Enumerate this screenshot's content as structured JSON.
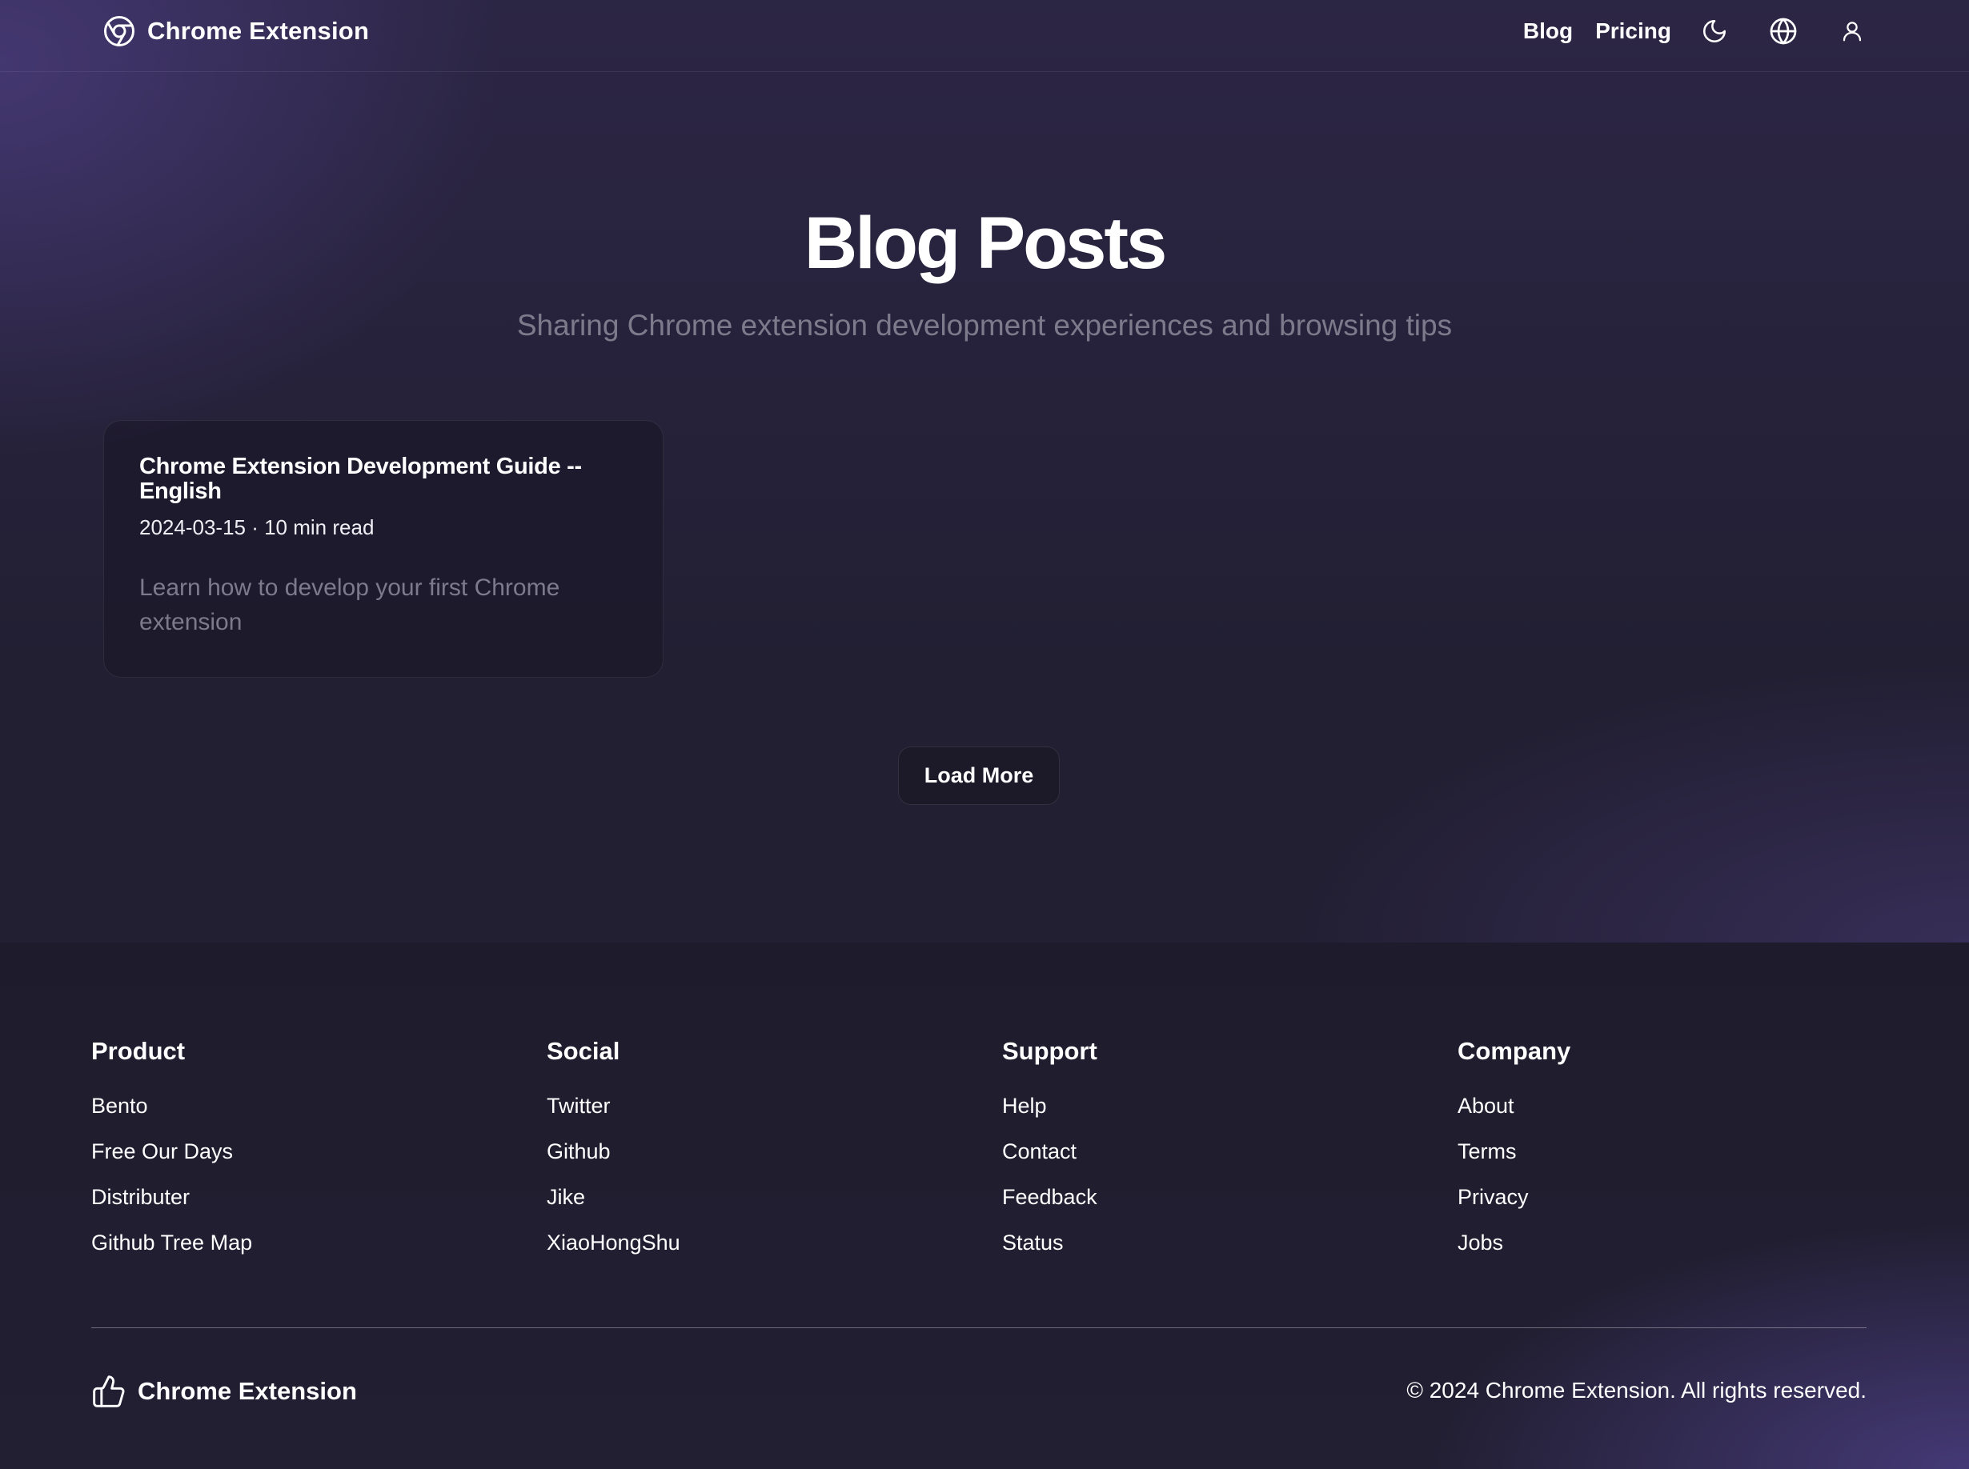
{
  "header": {
    "brand": "Chrome Extension",
    "nav": {
      "blog": "Blog",
      "pricing": "Pricing"
    },
    "icons": [
      "chrome-icon",
      "moon-icon",
      "globe-icon",
      "user-icon"
    ]
  },
  "hero": {
    "title": "Blog Posts",
    "subtitle": "Sharing Chrome extension development experiences and browsing tips"
  },
  "posts": [
    {
      "title": "Chrome Extension Development Guide -- English",
      "meta": "2024-03-15 · 10 min read",
      "description": "Learn how to develop your first Chrome extension"
    }
  ],
  "load_more": "Load More",
  "footer": {
    "columns": [
      {
        "heading": "Product",
        "links": [
          "Bento",
          "Free Our Days",
          "Distributer",
          "Github Tree Map"
        ]
      },
      {
        "heading": "Social",
        "links": [
          "Twitter",
          "Github",
          "Jike",
          "XiaoHongShu"
        ]
      },
      {
        "heading": "Support",
        "links": [
          "Help",
          "Contact",
          "Feedback",
          "Status"
        ]
      },
      {
        "heading": "Company",
        "links": [
          "About",
          "Terms",
          "Privacy",
          "Jobs"
        ]
      }
    ],
    "brand": "Chrome Extension",
    "copyright": "© 2024 Chrome Extension. All rights reserved."
  },
  "colors": {
    "background": "#221f33",
    "muted_text": "#7d7a8c",
    "accent_glow": "#584696"
  }
}
